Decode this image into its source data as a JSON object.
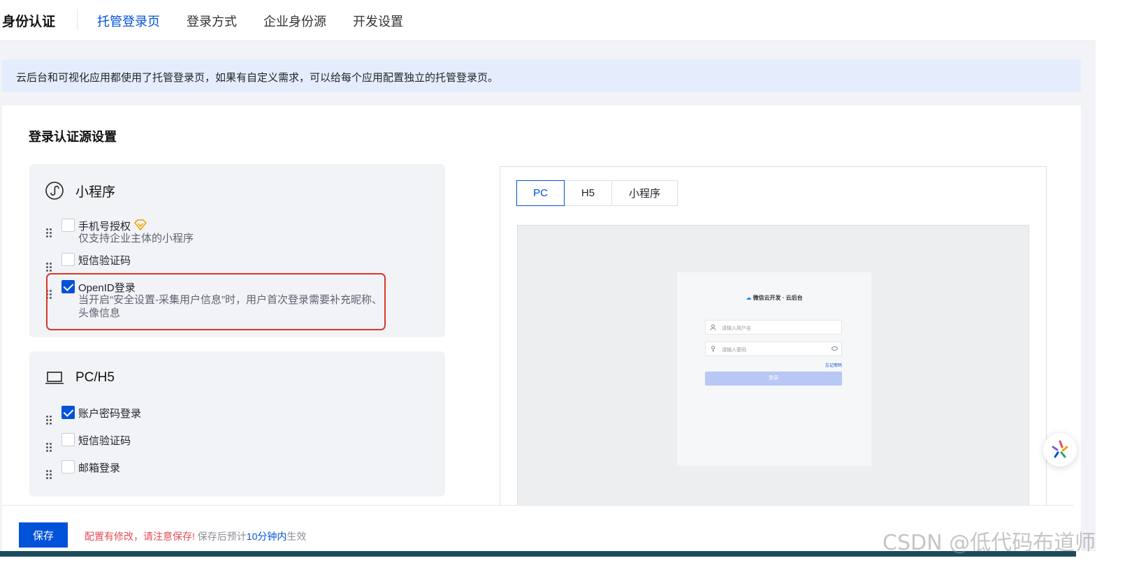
{
  "header": {
    "brand": "身份认证",
    "tabs": [
      {
        "label": "托管登录页",
        "active": true
      },
      {
        "label": "登录方式",
        "active": false
      },
      {
        "label": "企业身份源",
        "active": false
      },
      {
        "label": "开发设置",
        "active": false
      }
    ]
  },
  "notice": "云后台和可视化应用都使用了托管登录页，如果有自定义需求，可以给每个应用配置独立的托管登录页。",
  "section_title": "登录认证源设置",
  "mini_program": {
    "title": "小程序",
    "icon": "mini-program-icon",
    "options": [
      {
        "label": "手机号授权",
        "checked": false,
        "desc": "仅支持企业主体的小程序",
        "badge": "vip-diamond-icon"
      },
      {
        "label": "短信验证码",
        "checked": false
      },
      {
        "label": "OpenID登录",
        "checked": true,
        "desc": "当开启“安全设置-采集用户信息”时，用户首次登录需要补充昵称、头像信息"
      }
    ]
  },
  "pc_h5": {
    "title": "PC/H5",
    "icon": "laptop-icon",
    "options": [
      {
        "label": "账户密码登录",
        "checked": true
      },
      {
        "label": "短信验证码",
        "checked": false
      },
      {
        "label": "邮箱登录",
        "checked": false
      }
    ]
  },
  "preview": {
    "tabs": [
      {
        "label": "PC",
        "active": true
      },
      {
        "label": "H5",
        "active": false
      },
      {
        "label": "小程序",
        "active": false
      }
    ],
    "login": {
      "brand": "微信云开发 · 云后台",
      "username_placeholder": "请输入用户名",
      "password_placeholder": "请输入密码",
      "forgot": "忘记密码",
      "button": "登录"
    }
  },
  "footer": {
    "save": "保存",
    "warn": "配置有修改，请注意保存!",
    "muted_pre": "保存后预计",
    "highlight": "10分钟内",
    "muted_post": "生效"
  },
  "watermark": "CSDN @低代码布道师",
  "colors": {
    "accent": "#0052d9",
    "highlight_border": "#d63a2a",
    "warn": "#e34d59"
  }
}
